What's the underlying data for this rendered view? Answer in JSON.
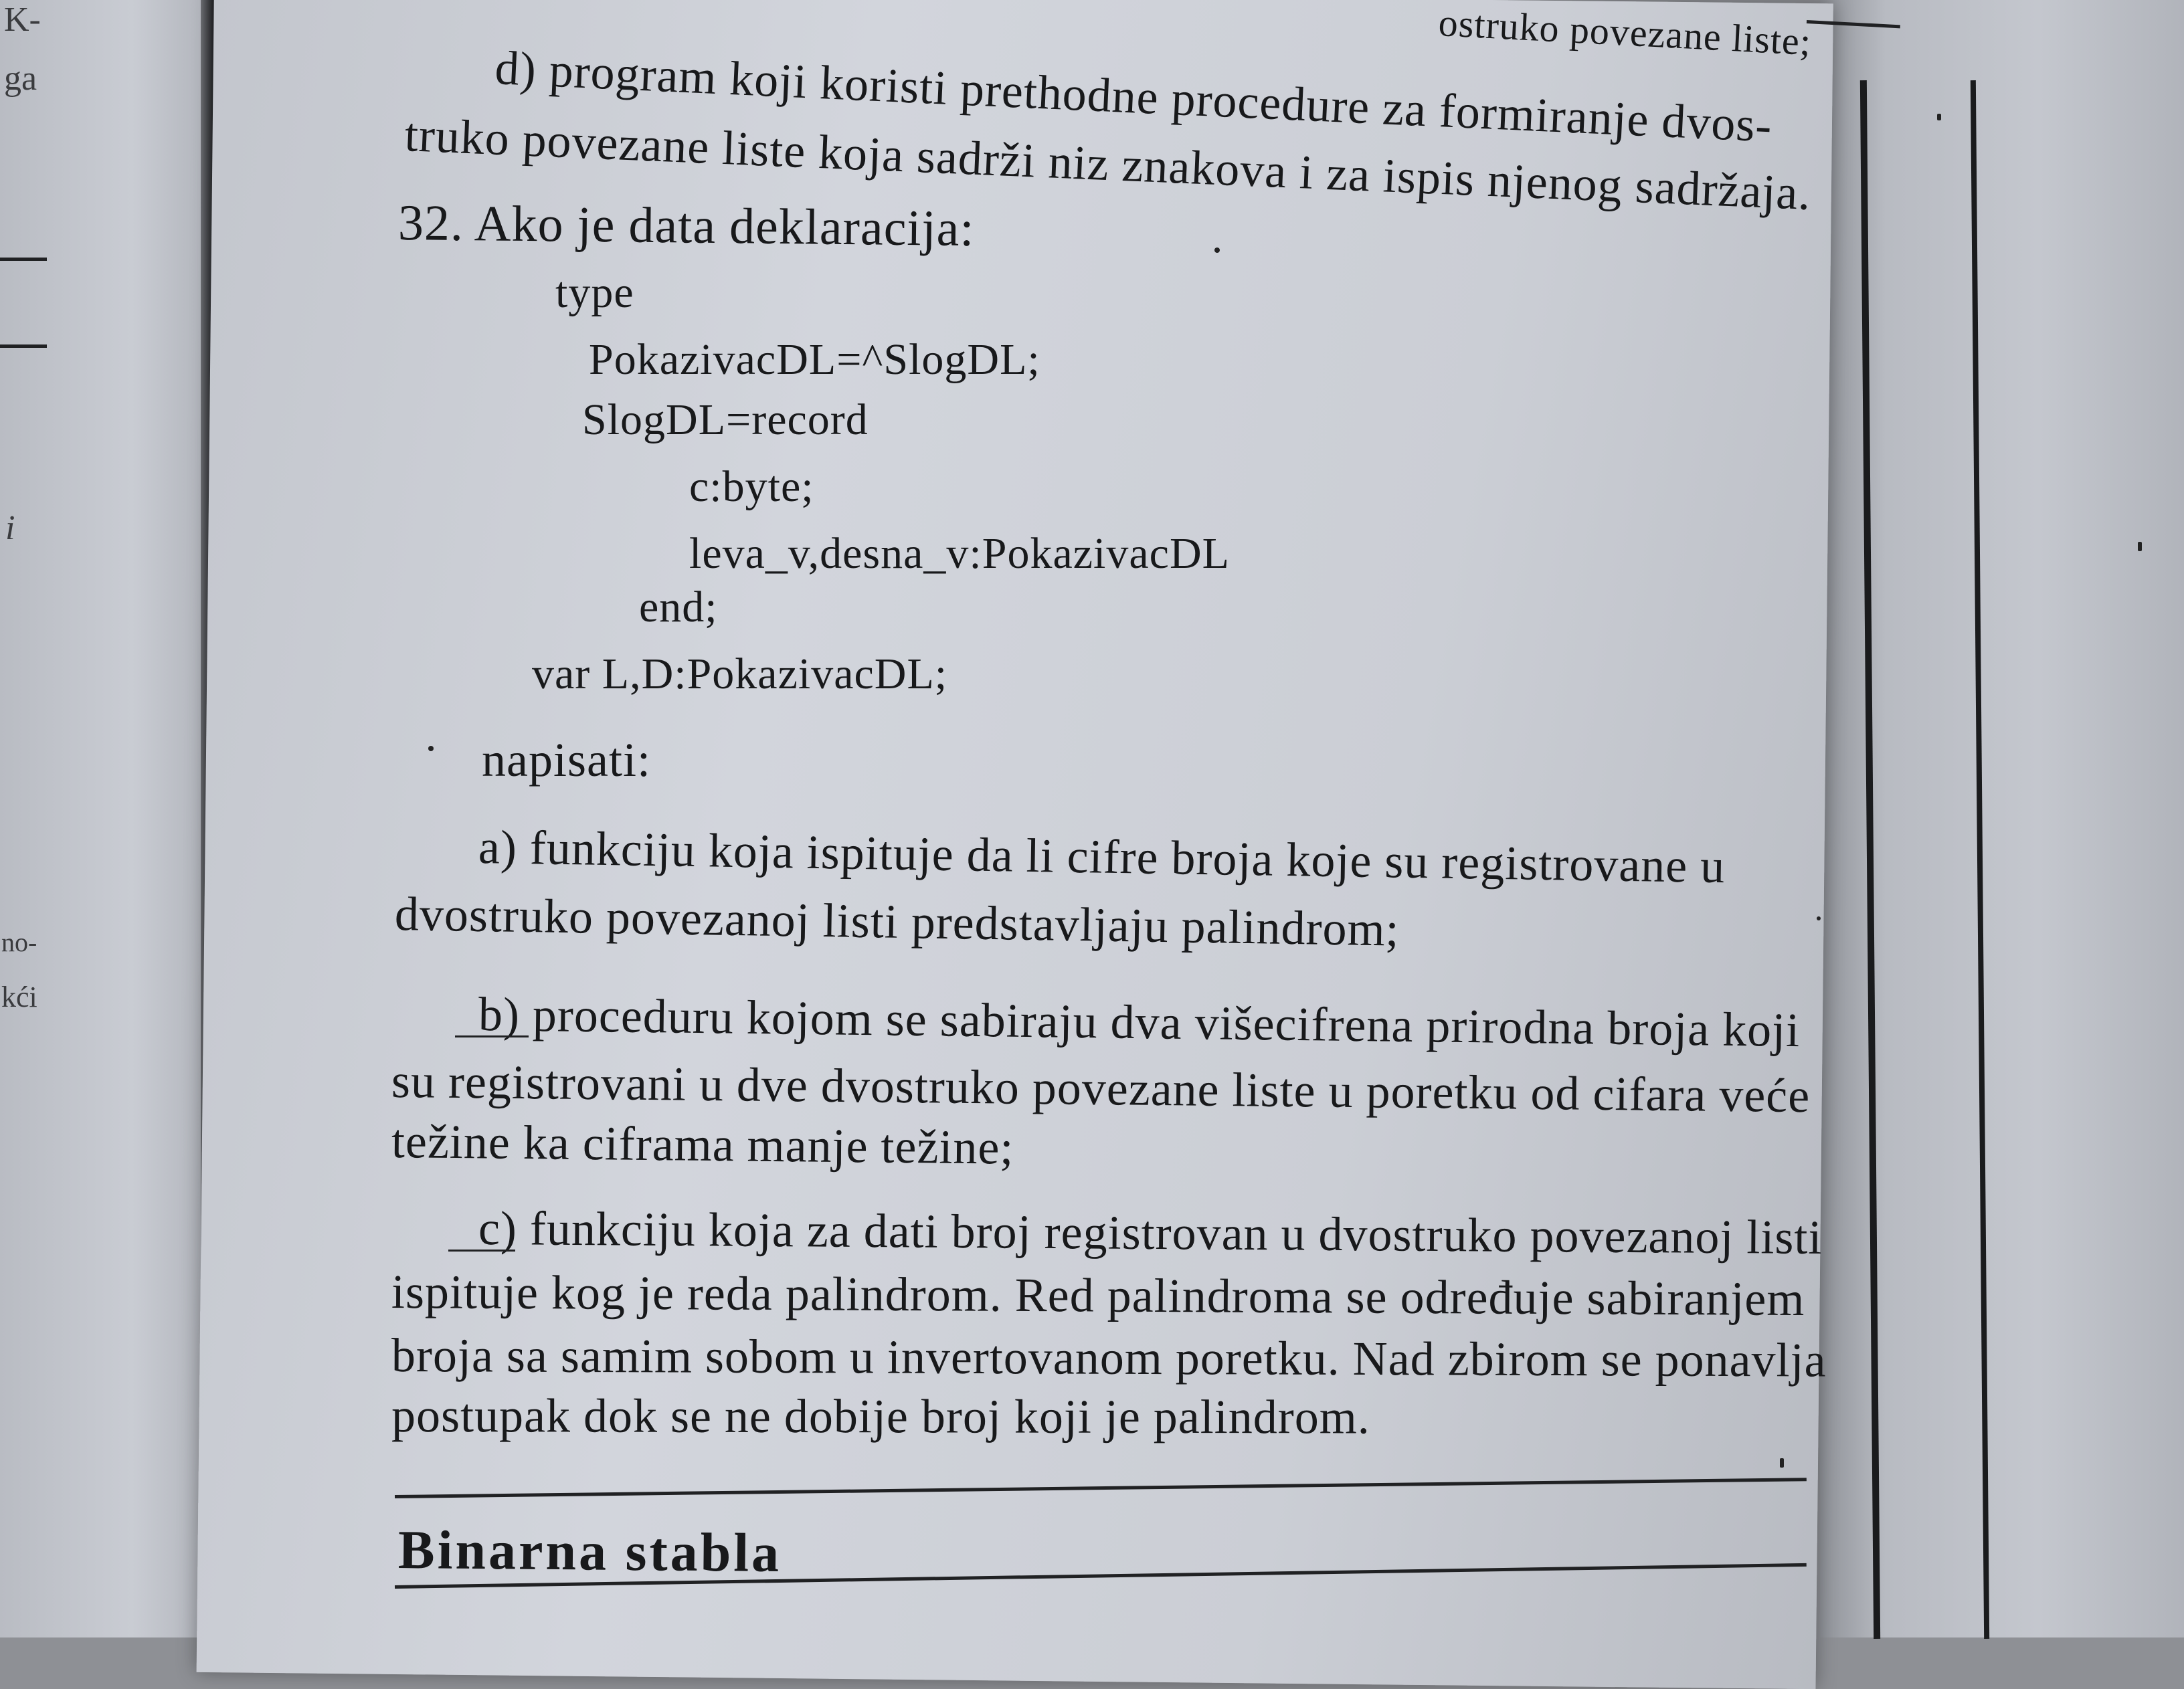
{
  "left_margin": {
    "fragments": [
      "K-",
      "ga",
      "i",
      "no-",
      "kći"
    ]
  },
  "top_partial": "ostruko povezane liste;",
  "item_d": {
    "line1": "d) program koji koristi prethodne procedure za formiranje dvos-",
    "line2": "truko povezane liste koja sadrži niz znakova i za ispis njenog sadržaja."
  },
  "problem": {
    "number_line": "32. Ako je data deklaracija:"
  },
  "code_lines": [
    "type",
    "PokazivacDL=^SlogDL;",
    "SlogDL=record",
    "c:byte;",
    "leva_v,desna_v:PokazivacDL",
    "end;",
    "var L,D:PokazivacDL;"
  ],
  "napisati": "napisati:",
  "item_a": {
    "line1": "a) funkciju koja ispituje da li cifre broja koje su registrovane u",
    "line2": "dvostruko povezanoj listi predstavljaju palindrom;"
  },
  "item_b": {
    "line1": "b) proceduru kojom se sabiraju dva višecifrena prirodna broja koji",
    "line2": "su registrovani u dve dvostruko povezane liste u poretku od cifara veće",
    "line3": "težine ka ciframa manje težine;"
  },
  "item_c": {
    "line1": "c) funkciju koja za dati broj registrovan u dvostruko povezanoj listi",
    "line2": "ispituje kog je reda palindrom. Red palindroma se određuje sabiranjem",
    "line3": "broja sa samim sobom u invertovanom poretku. Nad zbirom se ponavlja",
    "line4": "postupak dok se ne dobije broj koji je palindrom."
  },
  "section_heading": "Binarna stabla",
  "colors": {
    "paper": "#cfd2d9",
    "ink": "#18191b",
    "background": "#8e9095"
  }
}
